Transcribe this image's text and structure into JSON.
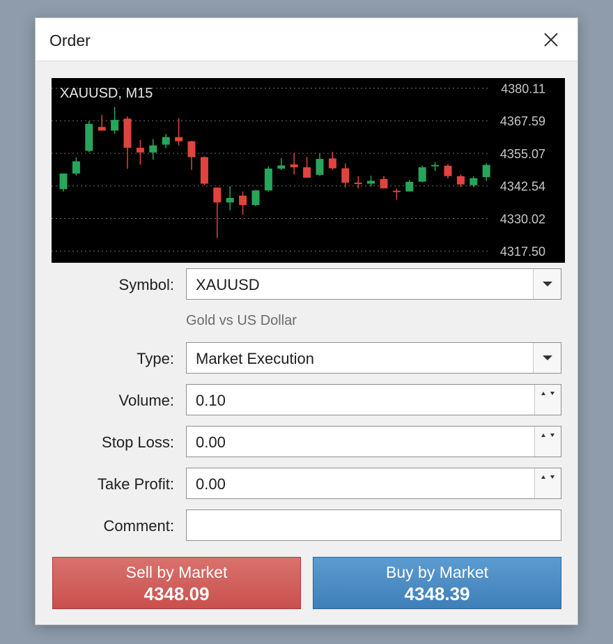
{
  "window": {
    "title": "Order"
  },
  "chart": {
    "symbol_label": "XAUUSD, M15",
    "price_levels": [
      "4380.11",
      "4367.59",
      "4355.07",
      "4342.54",
      "4330.02",
      "4317.50"
    ],
    "colors": {
      "bull": "#26a65b",
      "bear": "#e0443e",
      "grid": "#707070",
      "text": "#c8c8c8",
      "background": "#000000"
    }
  },
  "chart_data": {
    "type": "candlestick",
    "title": "XAUUSD, M15",
    "ylim": [
      4313,
      4384
    ],
    "yticks": [
      4380.11,
      4367.59,
      4355.07,
      4342.54,
      4330.02,
      4317.5
    ],
    "candles": [
      {
        "o": 4341.3,
        "h": 4346.5,
        "l": 4340.3,
        "c": 4347.3
      },
      {
        "o": 4347.3,
        "h": 4353.5,
        "l": 4346.5,
        "c": 4352.0
      },
      {
        "o": 4356.0,
        "h": 4367.5,
        "l": 4355.5,
        "c": 4366.4
      },
      {
        "o": 4365.2,
        "h": 4369.9,
        "l": 4363.9,
        "c": 4363.8
      },
      {
        "o": 4363.8,
        "h": 4372.9,
        "l": 4362.6,
        "c": 4367.9
      },
      {
        "o": 4368.4,
        "h": 4369.3,
        "l": 4349.1,
        "c": 4357.2
      },
      {
        "o": 4357.2,
        "h": 4360.2,
        "l": 4350.7,
        "c": 4355.4
      },
      {
        "o": 4355.4,
        "h": 4360.6,
        "l": 4352.6,
        "c": 4358.1
      },
      {
        "o": 4358.4,
        "h": 4362.5,
        "l": 4357.1,
        "c": 4361.3
      },
      {
        "o": 4361.3,
        "h": 4368.5,
        "l": 4358.1,
        "c": 4359.7
      },
      {
        "o": 4359.7,
        "h": 4359.9,
        "l": 4348.7,
        "c": 4353.6
      },
      {
        "o": 4353.6,
        "h": 4353.9,
        "l": 4342.8,
        "c": 4343.4
      },
      {
        "o": 4341.9,
        "h": 4341.9,
        "l": 4322.5,
        "c": 4336.2
      },
      {
        "o": 4336.2,
        "h": 4342.4,
        "l": 4333.1,
        "c": 4337.9
      },
      {
        "o": 4338.8,
        "h": 4340.4,
        "l": 4331.5,
        "c": 4335.2
      },
      {
        "o": 4335.2,
        "h": 4341.0,
        "l": 4334.7,
        "c": 4340.8
      },
      {
        "o": 4340.8,
        "h": 4350.1,
        "l": 4340.3,
        "c": 4349.2
      },
      {
        "o": 4349.2,
        "h": 4353.3,
        "l": 4348.6,
        "c": 4350.4
      },
      {
        "o": 4350.8,
        "h": 4355.2,
        "l": 4347.0,
        "c": 4349.7
      },
      {
        "o": 4349.7,
        "h": 4353.7,
        "l": 4346.0,
        "c": 4345.7
      },
      {
        "o": 4346.8,
        "h": 4354.9,
        "l": 4346.4,
        "c": 4352.9
      },
      {
        "o": 4353.1,
        "h": 4355.7,
        "l": 4348.7,
        "c": 4349.3
      },
      {
        "o": 4349.3,
        "h": 4351.2,
        "l": 4341.9,
        "c": 4343.8
      },
      {
        "o": 4343.8,
        "h": 4346.3,
        "l": 4341.6,
        "c": 4343.4
      },
      {
        "o": 4343.4,
        "h": 4346.4,
        "l": 4342.3,
        "c": 4344.5
      },
      {
        "o": 4345.2,
        "h": 4346.3,
        "l": 4341.5,
        "c": 4341.6
      },
      {
        "o": 4340.7,
        "h": 4341.5,
        "l": 4337.2,
        "c": 4340.4
      },
      {
        "o": 4340.4,
        "h": 4344.8,
        "l": 4340.4,
        "c": 4344.1
      },
      {
        "o": 4344.2,
        "h": 4350.3,
        "l": 4343.9,
        "c": 4349.7
      },
      {
        "o": 4350.3,
        "h": 4351.7,
        "l": 4348.3,
        "c": 4350.6
      },
      {
        "o": 4350.3,
        "h": 4350.9,
        "l": 4345.4,
        "c": 4346.3
      },
      {
        "o": 4346.3,
        "h": 4346.9,
        "l": 4342.1,
        "c": 4343.1
      },
      {
        "o": 4342.8,
        "h": 4346.3,
        "l": 4342.0,
        "c": 4345.5
      },
      {
        "o": 4345.9,
        "h": 4351.2,
        "l": 4344.4,
        "c": 4350.6
      }
    ]
  },
  "form": {
    "symbol": {
      "label": "Symbol:",
      "value": "XAUUSD",
      "description": "Gold vs US Dollar"
    },
    "type": {
      "label": "Type:",
      "value": "Market Execution"
    },
    "volume": {
      "label": "Volume:",
      "value": "0.10"
    },
    "stop_loss": {
      "label": "Stop Loss:",
      "value": "0.00"
    },
    "take_profit": {
      "label": "Take Profit:",
      "value": "0.00"
    },
    "comment": {
      "label": "Comment:",
      "value": ""
    }
  },
  "buttons": {
    "sell": {
      "label": "Sell by Market",
      "price": "4348.09",
      "color": "#c9504c"
    },
    "buy": {
      "label": "Buy by Market",
      "price": "4348.39",
      "color": "#3f7fb8"
    }
  },
  "icons": {
    "close": "close-icon",
    "dropdown": "chevron-down-icon",
    "spinner": "spinner-arrows-icon"
  }
}
